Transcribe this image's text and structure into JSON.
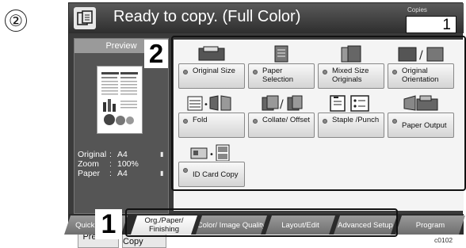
{
  "step_marker": "②",
  "header": {
    "status": "Ready to copy. (Full Color)",
    "copies_label": "Copies",
    "copies_value": "1"
  },
  "left_panel": {
    "preview_title": "Preview",
    "info": [
      {
        "key": "Original",
        "sep": ":",
        "value": "A4"
      },
      {
        "key": "Zoom",
        "sep": ":",
        "value": "100%"
      },
      {
        "key": "Paper",
        "sep": ":",
        "value": "A4"
      }
    ],
    "preview_button": "Preview",
    "proof_copy_button": "Proof Copy"
  },
  "functions": [
    {
      "label": "Original Size",
      "icon": "original-size-icon"
    },
    {
      "label": "Paper Selection",
      "icon": "paper-selection-icon"
    },
    {
      "label": "Mixed Size Originals",
      "icon": "mixed-size-icon"
    },
    {
      "label": "Original Orientation",
      "icon": "orientation-icon"
    },
    {
      "label": "Fold",
      "icon": "fold-icon"
    },
    {
      "label": "Collate/ Offset",
      "icon": "collate-icon"
    },
    {
      "label": "Staple /Punch",
      "icon": "staple-icon"
    },
    {
      "label": "Paper Output",
      "icon": "paper-output-icon"
    },
    {
      "label": "ID Card Copy",
      "icon": "id-card-icon"
    }
  ],
  "tabs": [
    {
      "label": "Quick Setup"
    },
    {
      "label": "Org./Paper/ Finishing",
      "active": true
    },
    {
      "label": "Color/ Image Quality"
    },
    {
      "label": "Layout/Edit"
    },
    {
      "label": "Advanced Setup"
    },
    {
      "label": "Program"
    }
  ],
  "callouts": {
    "main_area": "2",
    "tabs": "1"
  },
  "figure_code": "c0102"
}
